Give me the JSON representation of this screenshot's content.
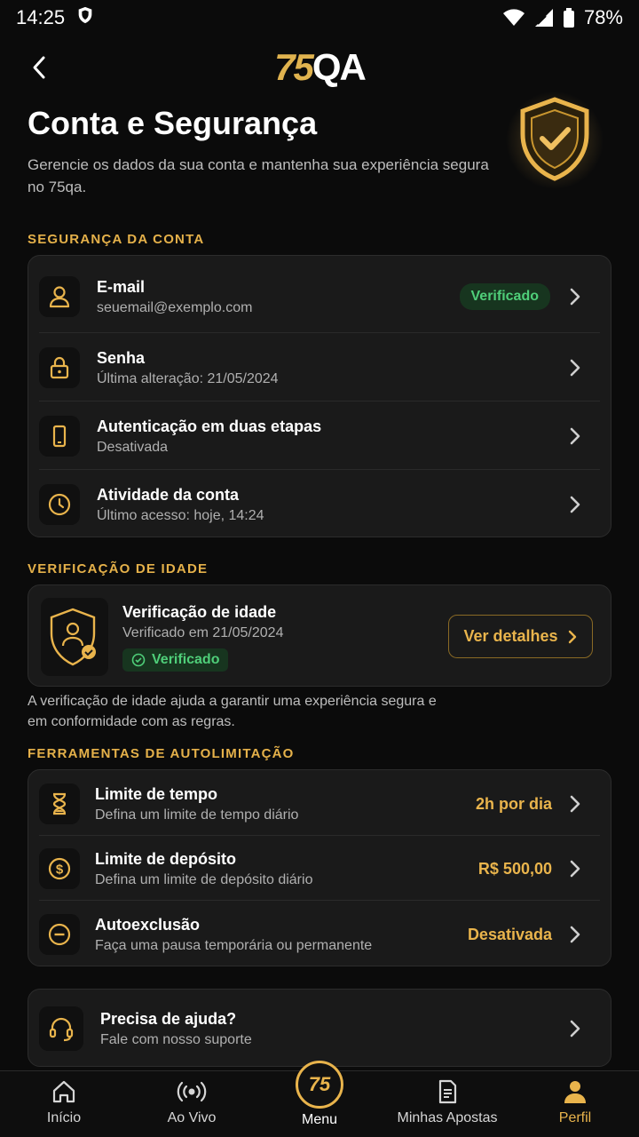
{
  "status_bar": {
    "time": "14:25",
    "battery": "78%"
  },
  "header": {
    "logo_num": "75",
    "logo_text": "QA",
    "title": "Conta e Segurança",
    "subtitle": "Gerencie os dados da sua conta e mantenha sua experiência segura no 75qa."
  },
  "security": {
    "section_title": "SEGURANÇA DA CONTA",
    "rows": [
      {
        "title": "E-mail",
        "sub": "seuemail@exemplo.com",
        "badge": "Verificado",
        "icon": "user-icon"
      },
      {
        "title": "Senha",
        "sub": "Última alteração: 21/05/2024",
        "icon": "lock-icon"
      },
      {
        "title": "Autenticação em duas etapas",
        "sub": "Desativada",
        "icon": "phone-icon"
      },
      {
        "title": "Atividade da conta",
        "sub": "Último acesso: hoje, 14:24",
        "icon": "clock-icon"
      }
    ]
  },
  "age": {
    "section_title": "VERIFICAÇÃO DE IDADE",
    "title": "Verificação de idade",
    "sub": "Verificado em 21/05/2024",
    "pill": "Verificado",
    "button": "Ver detalhes",
    "note": "A verificação de idade ajuda a garantir uma experiência segura e em conformidade com as regras."
  },
  "tools": {
    "section_title": "FERRAMENTAS DE AUTOLIMITAÇÃO",
    "rows": [
      {
        "title": "Limite de tempo",
        "sub": "Defina um limite de tempo diário",
        "value": "2h por dia",
        "icon": "hourglass-icon"
      },
      {
        "title": "Limite de depósito",
        "sub": "Defina um limite de depósito diário",
        "value": "R$ 500,00",
        "icon": "dollar-icon"
      },
      {
        "title": "Autoexclusão",
        "sub": "Faça uma pausa temporária ou permanente",
        "value": "Desativada",
        "icon": "minus-circle-icon"
      }
    ]
  },
  "help": {
    "title": "Precisa de ajuda?",
    "sub": "Fale com nosso suporte"
  },
  "nav": {
    "items": [
      {
        "label": "Início"
      },
      {
        "label": "Ao Vivo"
      },
      {
        "label": "Menu",
        "badge": "75"
      },
      {
        "label": "Minhas Apostas"
      },
      {
        "label": "Perfil"
      }
    ]
  },
  "colors": {
    "accent": "#e9b44c",
    "success": "#4fce79",
    "background": "#0b0b0b",
    "card": "#1a1a1a"
  }
}
